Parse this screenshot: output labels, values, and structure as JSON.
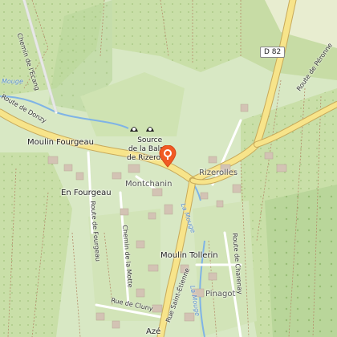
{
  "map": {
    "places": {
      "moulin_fourgeau": "Moulin Fourgeau",
      "en_fourgeau": "En Fourgeau",
      "montchanin": "Montchanin",
      "rizerolles": "Rizerolles",
      "moulin_tollerin": "Moulin Tollerin",
      "pinagot": "Pinagot",
      "aze": "Azé"
    },
    "roads": {
      "d82": "D 82",
      "route_donzy": "Route de Donzy",
      "route_peronne": "Route de Péronne",
      "chemin_ecang": "Chemin de l'Ecang",
      "route_fourgeau": "Route de Fourgeau",
      "chemin_motte": "Chemin de la Motte",
      "route_cluny": "Rue de Cluny",
      "rue_saint_etienne": "Rue Saint-Étienne",
      "route_charenay": "Route de Charenay"
    },
    "water": {
      "la_mouge_left": "Mouge",
      "la_mouge_1": "La Mouge",
      "la_mouge_2": "La Mouge"
    },
    "poi": {
      "source_line1": "Source",
      "source_line2": "de la Balme",
      "source_line3": "de Rizerolles"
    }
  }
}
